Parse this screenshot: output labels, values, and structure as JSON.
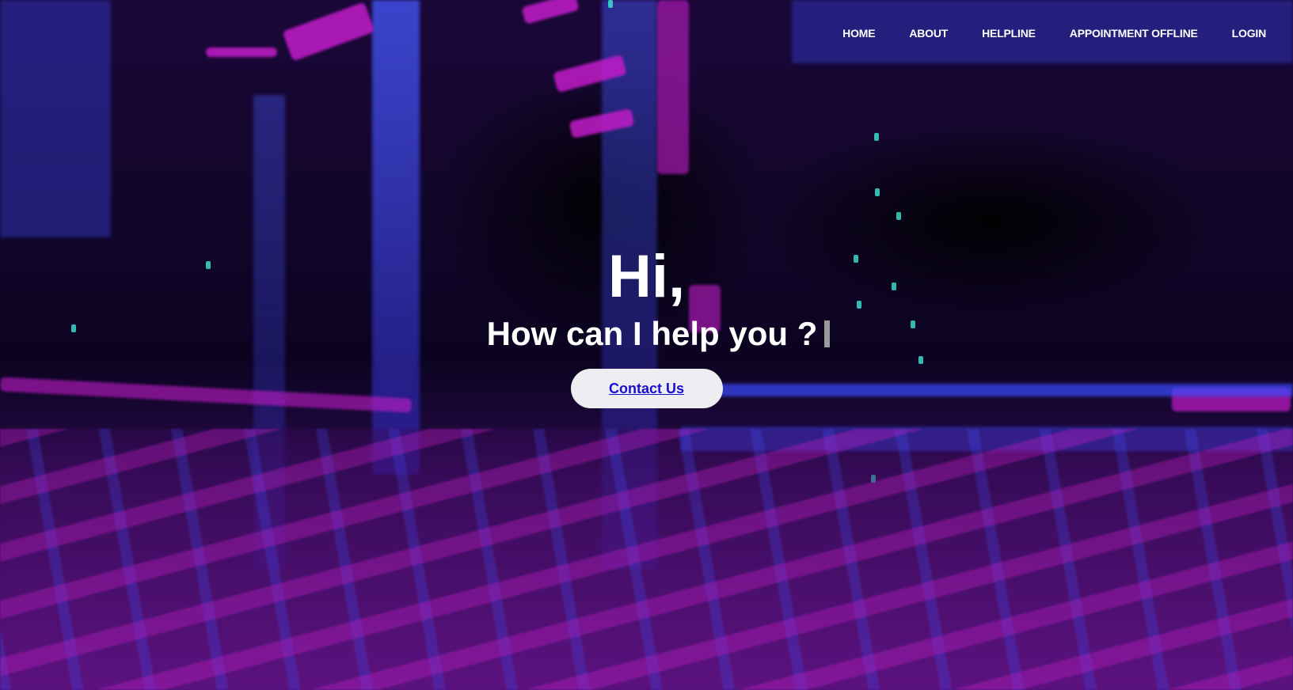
{
  "nav": {
    "items": [
      {
        "label": "HOME"
      },
      {
        "label": "ABOUT"
      },
      {
        "label": "HELPLINE"
      },
      {
        "label": "APPOINTMENT OFFLINE"
      },
      {
        "label": "LOGIN"
      }
    ]
  },
  "hero": {
    "greeting": "Hi,",
    "subtitle": "How can I help you ?",
    "cta_label": "Contact Us"
  },
  "colors": {
    "background_magenta": "#c21cc9",
    "background_blue": "#3a4bff",
    "cta_background": "#eeeef2",
    "cta_text": "#1a0fd0",
    "text": "#ffffff"
  }
}
